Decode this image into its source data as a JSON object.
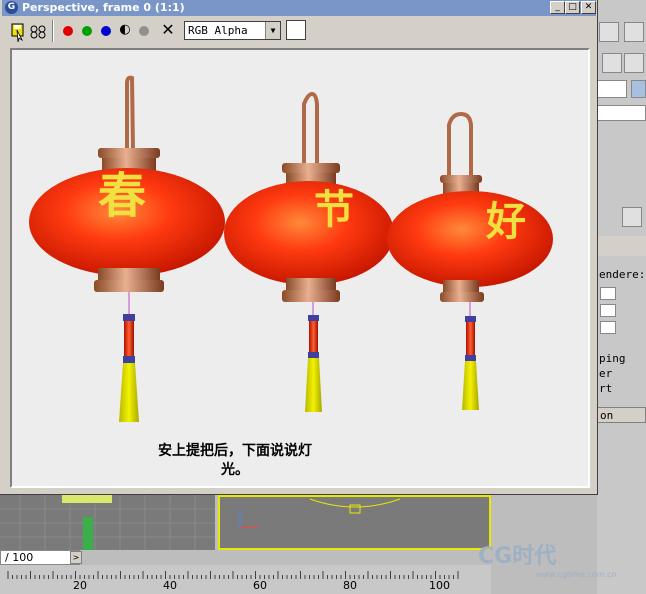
{
  "window": {
    "title": "Perspective, frame 0 (1:1)",
    "title_icon": "G",
    "minimize": "_",
    "maximize": "□",
    "close": "✕"
  },
  "toolbar": {
    "save_icon": "save-icon",
    "clone_icon": "clone-icon",
    "channel_red": "#e00000",
    "channel_green": "#00a000",
    "channel_blue": "#0000d0",
    "mono_glyph": "◐",
    "clear_glyph": "✕",
    "channel_select": "RGB Alpha",
    "select_arrow": "▼"
  },
  "lanterns": [
    {
      "char": "春"
    },
    {
      "char": "节"
    },
    {
      "char": "好"
    }
  ],
  "caption": {
    "line1": "安上提把后，下面说说灯",
    "line2": "光。"
  },
  "background_app": {
    "right_panel_texts": [
      "endere:",
      "ping",
      "er",
      "rt",
      "on"
    ],
    "timeline_value": "/ 100",
    "ruler_labels": [
      "20",
      "40",
      "60",
      "80",
      "100"
    ]
  },
  "watermark": {
    "main": "CG时代",
    "sub": "www.cgtime.com.cn"
  }
}
